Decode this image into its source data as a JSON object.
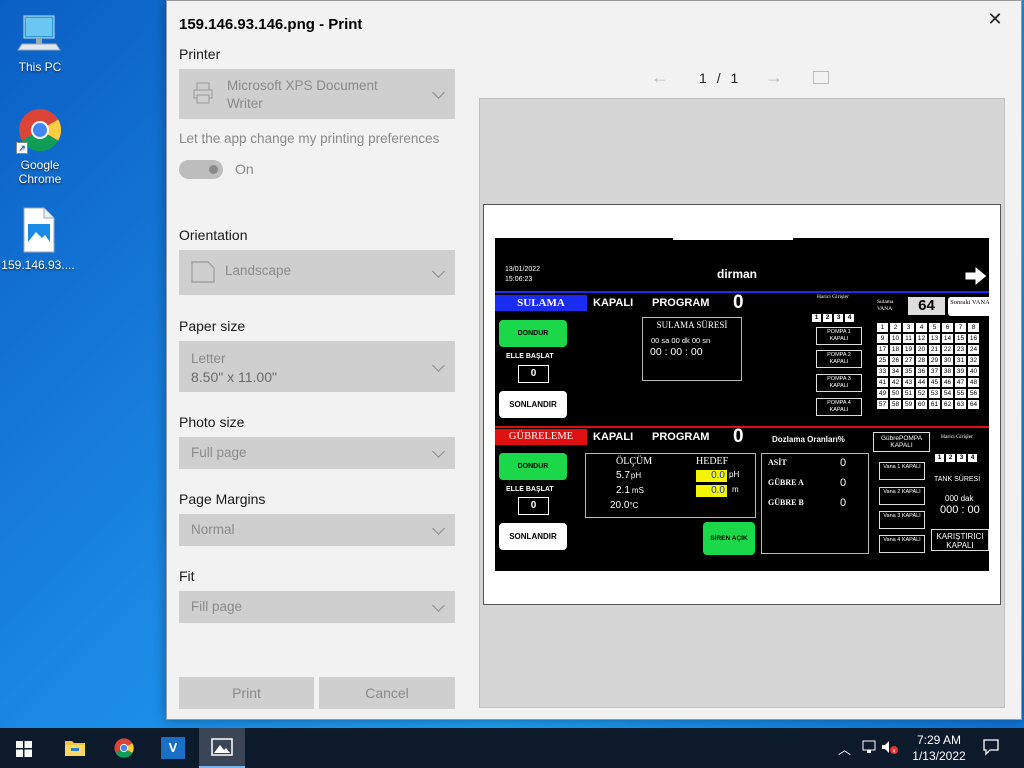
{
  "desktop": {
    "icons": [
      {
        "label": "This PC",
        "icon": "computer-icon"
      },
      {
        "label": "Google Chrome",
        "label_line1": "Google",
        "label_line2": "Chrome",
        "icon": "chrome-icon"
      },
      {
        "label": "159.146.93....",
        "icon": "image-file-icon"
      }
    ]
  },
  "dialog": {
    "title": "159.146.93.146.png - Print",
    "printer_label": "Printer",
    "printer_value_line1": "Microsoft XPS Document",
    "printer_value_line2": "Writer",
    "app_change_label": "Let the app change my printing preferences",
    "toggle_state": "On",
    "orientation_label": "Orientation",
    "orientation_value": "Landscape",
    "paper_size_label": "Paper size",
    "paper_size_line1": "Letter",
    "paper_size_line2": "8.50\" x 11.00\"",
    "photo_size_label": "Photo size",
    "photo_size_value": "Full page",
    "margins_label": "Page Margins",
    "margins_value": "Normal",
    "fit_label": "Fit",
    "fit_value": "Fill page",
    "print_button": "Print",
    "cancel_button": "Cancel",
    "page_current": "1",
    "page_separator": "/",
    "page_total": "1"
  },
  "preview": {
    "date": "13/01/2022",
    "time": "15:06:23",
    "site": "dirman",
    "sulama": {
      "header": "SULAMA",
      "status": "KAPALI",
      "program_label": "PROGRAM",
      "program_value": "0",
      "dondur": "DONDUR",
      "elle_baslat": "ELLE BAŞLAT",
      "elle_value": "0",
      "sonlandir": "SONLANDIR",
      "sure_title": "SULAMA SÜRESİ",
      "sure_units": "00 sa  00  dk  00 sn",
      "sure_values": "00 : 00 : 00",
      "harici_label": "Harici Girişler",
      "harici_nums": [
        "1",
        "2",
        "3",
        "4"
      ],
      "sulama_vana_label": "Sulama VANA",
      "sulama_vana_value": "64",
      "sonraki_vana": "Sonraki VANA",
      "pompalar": [
        "POMPA 1 KAPALI",
        "POMPA 2 KAPALI",
        "POMPA 3 KAPALI",
        "POMPA 4 KAPALI"
      ],
      "vanalar": [
        "1",
        "2",
        "3",
        "4",
        "5",
        "6",
        "7",
        "8",
        "9",
        "10",
        "11",
        "12",
        "13",
        "14",
        "15",
        "16",
        "17",
        "18",
        "19",
        "20",
        "21",
        "22",
        "23",
        "24",
        "25",
        "26",
        "27",
        "28",
        "29",
        "30",
        "31",
        "32",
        "33",
        "34",
        "35",
        "36",
        "37",
        "38",
        "39",
        "40",
        "41",
        "42",
        "43",
        "44",
        "45",
        "46",
        "47",
        "48",
        "49",
        "50",
        "51",
        "52",
        "53",
        "54",
        "55",
        "56",
        "57",
        "58",
        "59",
        "60",
        "61",
        "62",
        "63",
        "64"
      ]
    },
    "gubre": {
      "header": "GÜBRELEME",
      "status": "KAPALI",
      "program_label": "PROGRAM",
      "program_value": "0",
      "dozlama_label": "Dozlama Oranları%",
      "dondur": "DONDUR",
      "elle_baslat": "ELLE BAŞLAT",
      "elle_value": "0",
      "sonlandir": "SONLANDIR",
      "olcum_label": "ÖLÇÜM",
      "hedef_label": "HEDEF",
      "ph_measure": "5.7",
      "ph_unit": "pH",
      "ec_measure": "2.1",
      "ec_unit": "mS",
      "temp_measure": "20.0",
      "temp_unit": "°C",
      "ph_target": "0.0",
      "ph_target_unit": "pH",
      "ec_target": "0.0",
      "ec_target_unit": "m",
      "siren": "SİREN AÇIK",
      "asit_label": "ASİT",
      "asit_value": "0",
      "gubre_a_label": "GÜBRE A",
      "gubre_a_value": "0",
      "gubre_b_label": "GÜBRE B",
      "gubre_b_value": "0",
      "gubre_pompa": "GübrePOMPA KAPALI",
      "harici_label": "Harici Girişler",
      "harici_nums": [
        "1",
        "2",
        "3",
        "4"
      ],
      "vanalar": [
        "Vana 1 KAPALI",
        "Vana 2 KAPALI",
        "Vana 3 KAPALI",
        "Vana 4 KAPALI"
      ],
      "tank_suresi": "TANK SÜRESİ",
      "tank_dak": "000 dak",
      "tank_value": "000 : 00",
      "karistirici": "KARIŞTIRICI KAPALI"
    }
  },
  "taskbar": {
    "apps": [
      "start-icon",
      "file-explorer-icon",
      "chrome-icon",
      "vnc-icon",
      "photos-icon"
    ],
    "time": "7:29 AM",
    "date": "1/13/2022"
  },
  "colors": {
    "desktop_blue": "#0b6fd4",
    "green_button": "#1bd84a",
    "sulama_header": "#1a2cf0",
    "gubre_header": "#e01010",
    "target_yellow": "#f5f500"
  }
}
